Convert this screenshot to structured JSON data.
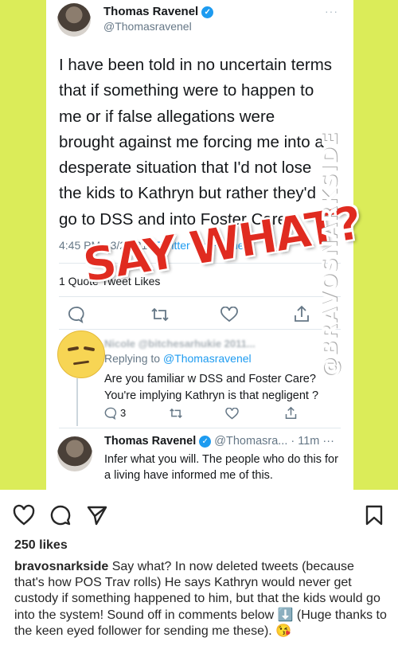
{
  "tweet": {
    "author_name": "Thomas Ravenel",
    "author_handle": "@Thomasravenel",
    "more": "···",
    "text": "I have been told in no uncertain terms that if something were to happen to me or if false allegations were brought against me forcing me into a desperate situation that I'd not lose the kids to Kathryn but rather they'd go to DSS and into Foster Care.",
    "time": "4:45 PM · 3/27/21 · ",
    "source": "Twitter for iPhone",
    "stats": "1 Quote Tweet  Likes"
  },
  "overlay": {
    "say_what": "SAY WHAT?",
    "watermark": "@BRAVOSNARKSIDE"
  },
  "reply": {
    "replying_prefix": "Replying to ",
    "replying_to": "@Thomasravenel",
    "text": "Are you familiar w DSS and Foster Care? You're implying Kathryn is that negligent ?",
    "reply_count": "3"
  },
  "reply2": {
    "author_name": "Thomas Ravenel",
    "author_handle": "@Thomasra...",
    "time": " · 11m",
    "more": "···",
    "text": "Infer what you will.  The people who do this for a living have informed me of this."
  },
  "post": {
    "likes": "250 likes",
    "username": "bravosnarkside",
    "caption": " Say what? In now deleted tweets (because that's how POS Trav rolls) He says Kathryn would never get custody if something happened to him, but that the kids would go into the system! Sound off in comments below ⬇️ (Huge thanks to the keen eyed follower for sending me these). 😘"
  },
  "icons": {
    "verified": "✓",
    "reply": "○",
    "retweet": "⇄",
    "like": "♡",
    "share": "⇪"
  },
  "colors": {
    "background": "#dbec59",
    "twitter_blue": "#1d9bf0",
    "say_what_red": "#e02b20"
  }
}
